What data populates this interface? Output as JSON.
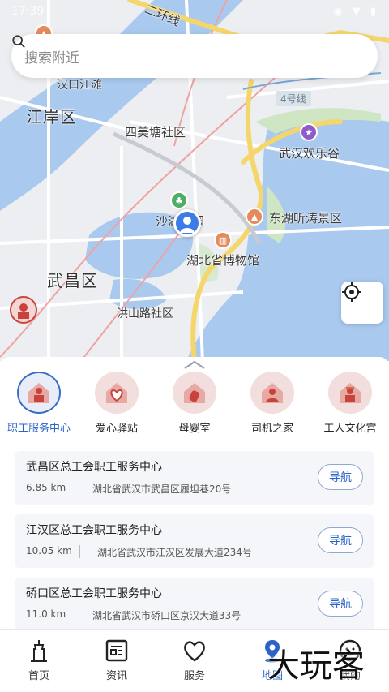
{
  "status_bar": {
    "time": "17:39"
  },
  "map": {
    "labels": {
      "er_huan_xian": "二环线",
      "hankou_jiangtan": "汉口江滩",
      "jiangan_qu": "江岸区",
      "simeitang": "四美塘社区",
      "wuhan_huanlegu": "武汉欢乐谷",
      "shahu": "沙湖公园",
      "donghu": "东湖听涛景区",
      "bowuguan": "湖北省博物馆",
      "wuchang_qu": "武昌区",
      "hongshanlu": "洪山路社区",
      "road_4": "4号线"
    }
  },
  "search": {
    "placeholder": "搜索附近"
  },
  "categories": [
    {
      "label": "职工服务中心",
      "icon": "worker-service-center-icon",
      "active": true
    },
    {
      "label": "爱心驿站",
      "icon": "love-station-icon",
      "active": false
    },
    {
      "label": "母婴室",
      "icon": "mother-baby-room-icon",
      "active": false
    },
    {
      "label": "司机之家",
      "icon": "driver-home-icon",
      "active": false
    },
    {
      "label": "工人文化宫",
      "icon": "workers-cultural-palace-icon",
      "active": false
    }
  ],
  "results": [
    {
      "title": "武昌区总工会职工服务中心",
      "distance": "6.85 km",
      "address": "湖北省武汉市武昌区履坦巷20号",
      "nav_label": "导航"
    },
    {
      "title": "江汉区总工会职工服务中心",
      "distance": "10.05 km",
      "address": "湖北省武汉市江汉区发展大道234号",
      "nav_label": "导航"
    },
    {
      "title": "硚口区总工会职工服务中心",
      "distance": "11.0 km",
      "address": "湖北省武汉市硚口区京汉大道33号",
      "nav_label": "导航"
    }
  ],
  "tabs": [
    {
      "label": "首页",
      "icon": "home-tower-icon",
      "active": false
    },
    {
      "label": "资讯",
      "icon": "news-icon",
      "active": false
    },
    {
      "label": "服务",
      "icon": "heart-icon",
      "active": false
    },
    {
      "label": "地图",
      "icon": "map-pin-icon",
      "active": true
    },
    {
      "label": "我的",
      "icon": "profile-icon",
      "active": false
    }
  ],
  "watermark": "大玩客",
  "colors": {
    "accent": "#2b63c8",
    "water": "#a9c9ef",
    "road_major": "#f5d66b",
    "category_bg": "#f1dedd"
  }
}
